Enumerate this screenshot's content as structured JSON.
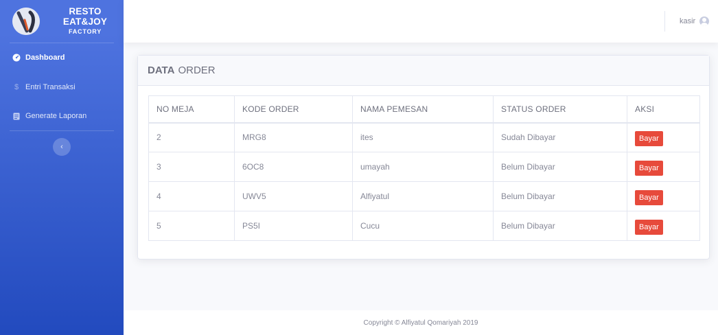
{
  "brand": {
    "title": "RESTO EAT&JOY",
    "subtitle": "FACTORY"
  },
  "sidebar": {
    "items": [
      {
        "label": "Dashboard",
        "icon": "tachometer-icon",
        "active": true
      },
      {
        "label": "Entri Transaksi",
        "icon": "dollar-icon",
        "active": false
      },
      {
        "label": "Generate Laporan",
        "icon": "document-icon",
        "active": false
      }
    ],
    "toggle_glyph": "‹"
  },
  "topbar": {
    "user_name": "kasir",
    "user_icon": "user-circle-icon"
  },
  "card": {
    "title_bold": "DATA",
    "title_rest": "ORDER"
  },
  "table": {
    "headers": [
      "NO MEJA",
      "KODE ORDER",
      "NAMA PEMESAN",
      "STATUS ORDER",
      "AKSI"
    ],
    "rows": [
      {
        "no_meja": "2",
        "kode_order": "MRG8",
        "nama_pemesan": "ites",
        "status": "Sudah Dibayar",
        "action": "Bayar"
      },
      {
        "no_meja": "3",
        "kode_order": "6OC8",
        "nama_pemesan": "umayah",
        "status": "Belum Dibayar",
        "action": "Bayar"
      },
      {
        "no_meja": "4",
        "kode_order": "UWV5",
        "nama_pemesan": "Alfiyatul",
        "status": "Belum Dibayar",
        "action": "Bayar"
      },
      {
        "no_meja": "5",
        "kode_order": "PS5I",
        "nama_pemesan": "Cucu",
        "status": "Belum Dibayar",
        "action": "Bayar"
      }
    ]
  },
  "footer": {
    "text": "Copyright © Alfiyatul Qomariyah 2019"
  },
  "colors": {
    "sidebar_start": "#4e73df",
    "sidebar_end": "#224abe",
    "danger": "#e74a3b"
  }
}
